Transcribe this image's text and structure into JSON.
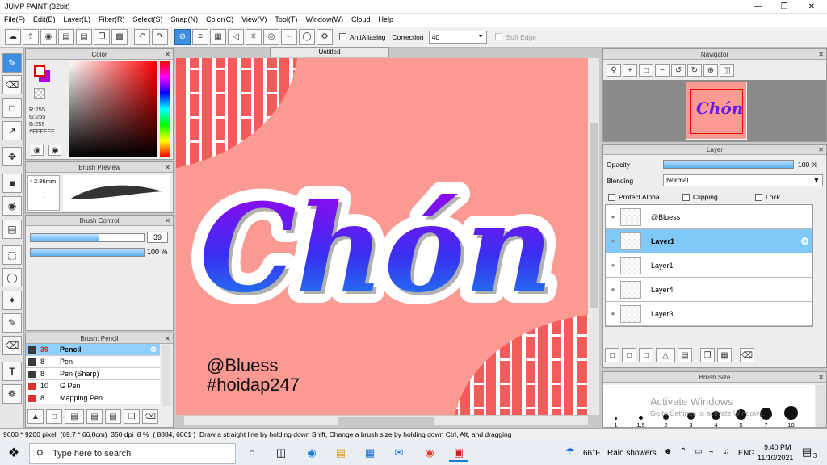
{
  "window": {
    "title": "JUMP PAINT (32bit)"
  },
  "menu": [
    "File(F)",
    "Edit(E)",
    "Layer(L)",
    "Filter(R)",
    "Select(S)",
    "Snap(N)",
    "Color(C)",
    "View(V)",
    "Tool(T)",
    "Window(W)",
    "Cloud",
    "Help"
  ],
  "toolbar": {
    "antialiasing": "AntiAliasing",
    "correction_label": "Correction",
    "correction_value": "40",
    "soft_edge": "Soft Edge"
  },
  "color_panel": {
    "title": "Color",
    "r": "R:255",
    "g": "G:255",
    "b": "B:255",
    "hex": "#FFFFFF",
    "fg": "#ffffff",
    "bg": "#b000d8"
  },
  "brush_preview": {
    "title": "Brush Preview",
    "size": "2.86mm"
  },
  "brush_control": {
    "title": "Brush Control",
    "size_value": "39",
    "size_fill": 0.6,
    "opacity_value": "100 %",
    "opacity_fill": 1.0
  },
  "brush_list": {
    "title": "Brush: Pencil",
    "items": [
      {
        "size": "39",
        "name": "Pencil",
        "color": "#3a3a3a",
        "selected": true
      },
      {
        "size": "8",
        "name": "Pen",
        "color": "#3a3a3a",
        "selected": false
      },
      {
        "size": "8",
        "name": "Pen (Sharp)",
        "color": "#3a3a3a",
        "selected": false
      },
      {
        "size": "10",
        "name": "G Pen",
        "color": "#e03030",
        "selected": false
      },
      {
        "size": "8",
        "name": "Mapping Pen",
        "color": "#e03030",
        "selected": false
      }
    ]
  },
  "canvas": {
    "tab": "Untitled",
    "title_text": "Chón",
    "handle": "@Bluess",
    "hashtag": "#hoidap247"
  },
  "navigator": {
    "title": "Navigator"
  },
  "layer_panel": {
    "title": "Layer",
    "opacity_label": "Opacity",
    "opacity_value": "100 %",
    "opacity_fill": 1.0,
    "blending_label": "Blending",
    "blending_value": "Normal",
    "protect_alpha": "Protect Alpha",
    "clipping": "Clipping",
    "lock": "Lock",
    "layers": [
      {
        "name": "@Bluess",
        "selected": false
      },
      {
        "name": "Layer1",
        "selected": true
      },
      {
        "name": "Layer1",
        "selected": false
      },
      {
        "name": "Layer4",
        "selected": false
      },
      {
        "name": "Layer3",
        "selected": false
      }
    ]
  },
  "brush_size": {
    "title": "Brush Size",
    "sizes": [
      "1",
      "1.5",
      "2",
      "3",
      "4",
      "5",
      "7",
      "10"
    ],
    "watermark1": "Activate Windows",
    "watermark2": "Go to Settings to activate Windows."
  },
  "status": {
    "pixel": "9600 * 9200 pixel",
    "dims": "(69.7 * 66.8cm)",
    "dpi": "350 dpi",
    "zoom": "8 %",
    "coords": "( 8884, 6061 )",
    "hint": "Draw a straight line by holding down Shift, Change a brush size by holding down Ctrl, Alt, and dragging"
  },
  "taskbar": {
    "search_placeholder": "Type here to search",
    "weather_temp": "66°F",
    "weather_text": "Rain showers",
    "lang": "ENG",
    "time": "9:40 PM",
    "date": "11/10/2021",
    "notif": "3"
  }
}
